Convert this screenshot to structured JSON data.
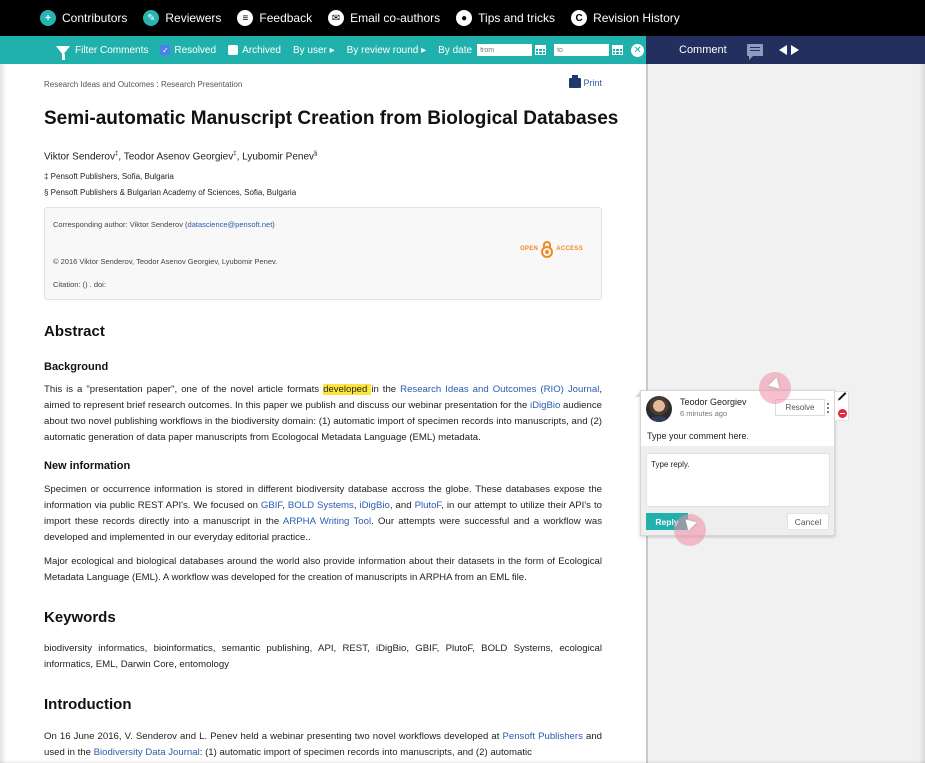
{
  "topbar": {
    "items": [
      {
        "label": "Contributors",
        "icon": "contributors-icon",
        "glyph": "+"
      },
      {
        "label": "Reviewers",
        "icon": "reviewers-icon",
        "glyph": "✎"
      },
      {
        "label": "Feedback",
        "icon": "feedback-icon",
        "glyph": "≡"
      },
      {
        "label": "Email co-authors",
        "icon": "email-icon",
        "glyph": "✉"
      },
      {
        "label": "Tips and tricks",
        "icon": "lightbulb-icon",
        "glyph": "●"
      },
      {
        "label": "Revision History",
        "icon": "revision-history-icon",
        "glyph": "C"
      }
    ]
  },
  "filterbar": {
    "filter_label": "Filter Comments",
    "resolved_label": "Resolved",
    "resolved_checked": true,
    "archived_label": "Archived",
    "archived_checked": false,
    "by_user": "By user ▸",
    "by_review_round": "By review round ▸",
    "by_date": "By date",
    "from_placeholder": "from",
    "to_placeholder": "to"
  },
  "commentbar": {
    "label": "Comment"
  },
  "document": {
    "breadcrumb": "Research Ideas and Outcomes : Research Presentation",
    "print_label": "Print",
    "title": "Semi-automatic Manuscript Creation from Biological Databases",
    "authors": [
      {
        "name": "Viktor Senderov",
        "mark": "‡"
      },
      {
        "name": "Teodor Asenov Georgiev",
        "mark": "‡"
      },
      {
        "name": "Lyubomir Penev",
        "mark": "§"
      }
    ],
    "affiliations": [
      "‡ Pensoft Publishers, Sofia, Bulgaria",
      "§ Pensoft Publishers & Bulgarian Academy of Sciences, Sofia, Bulgaria"
    ],
    "infobox": {
      "corresponding_prefix": "Corresponding author: Viktor Senderov (",
      "corresponding_email": "datascience@pensoft.net",
      "corresponding_suffix": ")",
      "copyright": "© 2016 Viktor Senderov, Teodor Asenov Georgiev, Lyubomir Penev.",
      "citation": "Citation: () . doi:",
      "oa_left": "OPEN",
      "oa_right": "ACCESS"
    },
    "abstract_heading": "Abstract",
    "background_heading": "Background",
    "background": {
      "t1": "This is a \"presentation paper\",  one of the novel article formats ",
      "highlight": "developed ",
      "t2": "in the ",
      "link1": "Research Ideas and Outcomes (RIO) Journal",
      "t3": ", aimed to represent brief research outcomes. In this paper we publish and discuss our webinar presentation for the ",
      "link2": "iDigBio",
      "t4": " audience about two novel publishing workflows in the biodiversity domain: (1) automatic import of specimen records into manuscripts, and (2) automatic generation of data paper manuscripts from Ecologocal Metadata Language (EML) metadata."
    },
    "newinfo_heading": "New information",
    "newinfo": {
      "t1": "Specimen or occurrence information is stored in different biodiversity database accross the globe. These databases expose the information via public REST API's. We focused on ",
      "l1": "GBIF",
      "t2": ", ",
      "l2": "BOLD Systems",
      "t3": ", ",
      "l3": "iDigBio",
      "t4": ", and ",
      "l4": "PlutoF",
      "t5": ", in our attempt to utilize their API's to import these records directly into a manuscript in the ",
      "l5": "ARPHA Writing Tool",
      "t6": ". Our attempts were successful and a workflow was developed and implemented in our everyday editorial practice.."
    },
    "newinfo2": "Major ecological and biological databases around the world also provide information about their datasets in the form of Ecological Metadata Language (EML). A workflow was developed for the creation of manuscripts in ARPHA from an EML file.",
    "keywords_heading": "Keywords",
    "keywords": "biodiversity informatics, bioinformatics, semantic publishing, API, REST, iDigBio, GBIF, PlutoF, BOLD Systems, ecological informatics, EML, Darwin Core, entomology",
    "intro_heading": "Introduction",
    "intro": {
      "t1": "On 16 June 2016, V. Senderov and L. Penev held a webinar presenting two novel workflows developed at ",
      "l1": "Pensoft Publishers",
      "t2": " and used in the ",
      "l2": "Biodiversity Data Journal",
      "t3": ": (1) automatic import of specimen records into manuscripts, and (2) automatic"
    }
  },
  "comment": {
    "author": "Teodor Georgiev",
    "time": "6 minutes ago",
    "text": "Type your comment here.",
    "resolve_label": "Resolve",
    "reply_value": "Type reply.",
    "reply_label": "Reply",
    "cancel_label": "Cancel"
  }
}
